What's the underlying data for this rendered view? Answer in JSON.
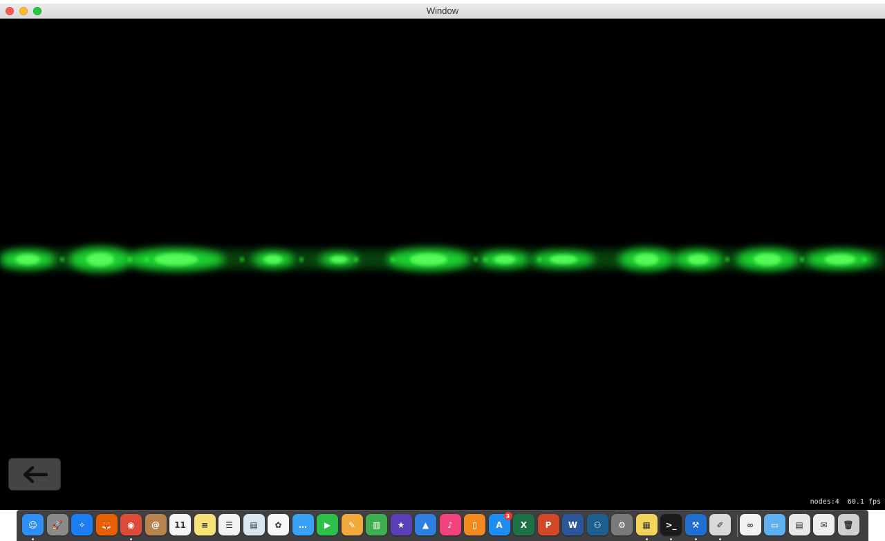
{
  "window": {
    "title": "Window"
  },
  "scene": {
    "background_color": "#000000",
    "beam_color": "#22ff3a",
    "stats": {
      "nodes": "nodes:4",
      "fps": "60.1 fps"
    }
  },
  "back_button": {
    "icon": "arrow-left-icon"
  },
  "dock": {
    "items": [
      {
        "name": "finder",
        "color": "#2f8ff5",
        "glyph": "☺",
        "running": true
      },
      {
        "name": "launchpad",
        "color": "#8a8a8a",
        "glyph": "🚀",
        "running": false
      },
      {
        "name": "safari",
        "color": "#1c7cf2",
        "glyph": "✧",
        "running": false
      },
      {
        "name": "firefox",
        "color": "#e66000",
        "glyph": "🦊",
        "running": false
      },
      {
        "name": "chrome",
        "color": "#dd4b39",
        "glyph": "◉",
        "running": true
      },
      {
        "name": "contacts",
        "color": "#b5844f",
        "glyph": "@",
        "running": false
      },
      {
        "name": "calendar",
        "color": "#f5f5f5",
        "glyph": "11",
        "running": false
      },
      {
        "name": "notes",
        "color": "#f7e27a",
        "glyph": "≡",
        "running": false
      },
      {
        "name": "reminders",
        "color": "#f2f2f2",
        "glyph": "☰",
        "running": false
      },
      {
        "name": "preview",
        "color": "#d9e7f5",
        "glyph": "▤",
        "running": false
      },
      {
        "name": "photos",
        "color": "#f7f7f7",
        "glyph": "✿",
        "running": false
      },
      {
        "name": "messages",
        "color": "#3aa0f5",
        "glyph": "…",
        "running": false
      },
      {
        "name": "facetime",
        "color": "#2dbf4c",
        "glyph": "▶",
        "running": false
      },
      {
        "name": "pages",
        "color": "#f2a93b",
        "glyph": "✎",
        "running": false
      },
      {
        "name": "numbers",
        "color": "#3fae50",
        "glyph": "▥",
        "running": false
      },
      {
        "name": "imovie",
        "color": "#5a3fb8",
        "glyph": "★",
        "running": false
      },
      {
        "name": "keynote",
        "color": "#2f7fe0",
        "glyph": "▲",
        "running": false
      },
      {
        "name": "itunes",
        "color": "#f2427c",
        "glyph": "♪",
        "running": false
      },
      {
        "name": "ibooks",
        "color": "#f28a20",
        "glyph": "▯",
        "running": false
      },
      {
        "name": "app-store",
        "color": "#1e8ef5",
        "glyph": "A",
        "running": false,
        "badge": "3"
      },
      {
        "name": "excel",
        "color": "#1e7145",
        "glyph": "X",
        "running": false
      },
      {
        "name": "powerpoint",
        "color": "#d24726",
        "glyph": "P",
        "running": false
      },
      {
        "name": "word",
        "color": "#2b579a",
        "glyph": "W",
        "running": false
      },
      {
        "name": "people-app",
        "color": "#1f5f8f",
        "glyph": "⚇",
        "running": false
      },
      {
        "name": "system-preferences",
        "color": "#7a7a7a",
        "glyph": "⚙",
        "running": false
      },
      {
        "name": "stickies",
        "color": "#f3d35a",
        "glyph": "▦",
        "running": true
      },
      {
        "name": "terminal",
        "color": "#1b1b1b",
        "glyph": ">_",
        "running": true
      },
      {
        "name": "xcode",
        "color": "#1f6fd1",
        "glyph": "⚒",
        "running": true
      },
      {
        "name": "instruments",
        "color": "#d9d9d9",
        "glyph": "✐",
        "running": true
      },
      {
        "name": "network-app",
        "color": "#f2f2f2",
        "glyph": "∞",
        "running": false
      },
      {
        "name": "folder",
        "color": "#5fb0ef",
        "glyph": "▭",
        "running": false
      },
      {
        "name": "documents",
        "color": "#e8e8e8",
        "glyph": "▤",
        "running": false
      },
      {
        "name": "chrome-apps",
        "color": "#eeeeee",
        "glyph": "✉",
        "running": false
      },
      {
        "name": "trash",
        "color": "#cfcfcf",
        "glyph": "🗑",
        "running": false
      }
    ]
  }
}
